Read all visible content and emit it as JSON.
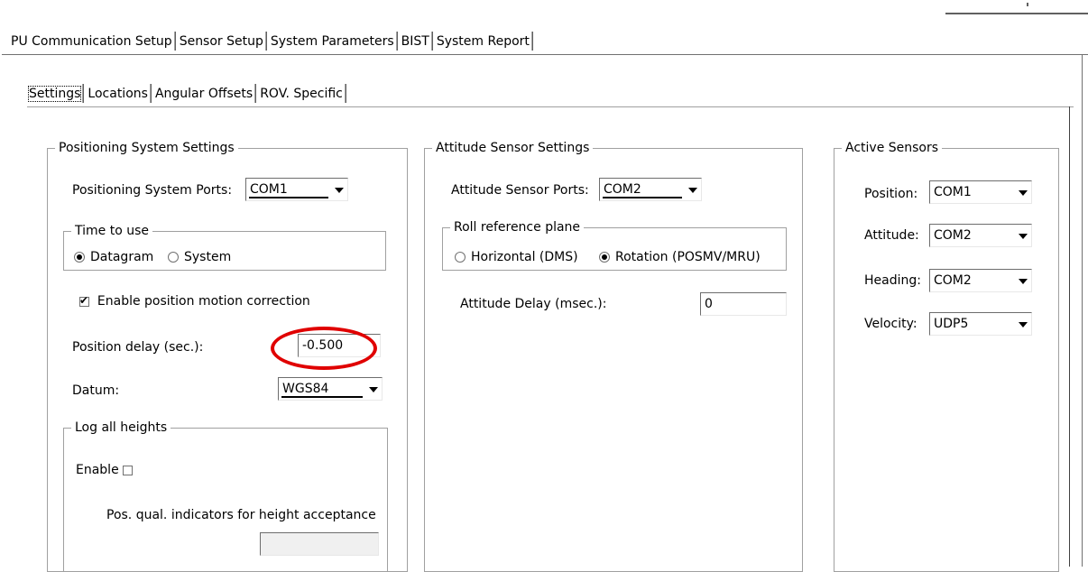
{
  "outer_tabs": [
    "PU Communication Setup",
    "Sensor Setup",
    "System Parameters",
    "BIST",
    "System Report"
  ],
  "inner_tabs": [
    "Settings",
    "Locations",
    "Angular Offsets",
    "ROV. Specific"
  ],
  "positioning": {
    "title": "Positioning System Settings",
    "ports_label": "Positioning System Ports:",
    "ports_value": "COM1",
    "time_group": "Time to use",
    "time_datagram": "Datagram",
    "time_system": "System",
    "motion_label": "Enable position motion correction",
    "delay_label": "Position delay (sec.):",
    "delay_value": "-0.500",
    "datum_label": "Datum:",
    "datum_value": "WGS84",
    "log_group": "Log all heights",
    "enable_label": "Enable",
    "pos_qual_label": "Pos. qual. indicators for height acceptance",
    "pos_qual_value": ""
  },
  "attitude": {
    "title": "Attitude Sensor Settings",
    "ports_label": "Attitude Sensor Ports:",
    "ports_value": "COM2",
    "roll_group": "Roll reference plane",
    "roll_horizontal": "Horizontal (DMS)",
    "roll_rotation": "Rotation (POSMV/MRU)",
    "delay_label": "Attitude Delay (msec.):",
    "delay_value": "0"
  },
  "active": {
    "title": "Active Sensors",
    "position_label": "Position:",
    "position_value": "COM1",
    "attitude_label": "Attitude:",
    "attitude_value": "COM2",
    "heading_label": "Heading:",
    "heading_value": "COM2",
    "velocity_label": "Velocity:",
    "velocity_value": "UDP5"
  },
  "colors": {
    "highlight": "#e00000",
    "border": "#a0a0a0"
  }
}
